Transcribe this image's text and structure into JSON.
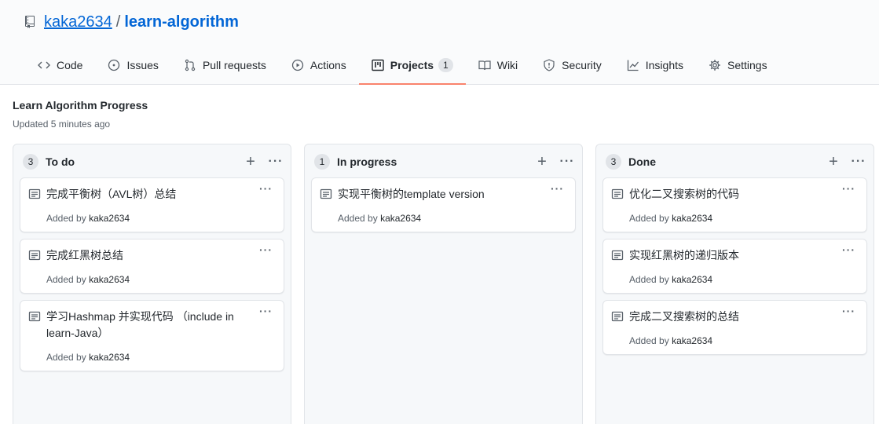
{
  "repo": {
    "owner": "kaka2634",
    "separator": "/",
    "name": "learn-algorithm"
  },
  "tabs": [
    {
      "label": "Code",
      "icon": "code-icon"
    },
    {
      "label": "Issues",
      "icon": "issue-icon"
    },
    {
      "label": "Pull requests",
      "icon": "pull-request-icon"
    },
    {
      "label": "Actions",
      "icon": "play-icon"
    },
    {
      "label": "Projects",
      "icon": "project-icon",
      "counter": "1",
      "selected": true
    },
    {
      "label": "Wiki",
      "icon": "book-icon"
    },
    {
      "label": "Security",
      "icon": "shield-icon"
    },
    {
      "label": "Insights",
      "icon": "graph-icon"
    },
    {
      "label": "Settings",
      "icon": "gear-icon"
    }
  ],
  "project": {
    "title": "Learn Algorithm Progress",
    "updated": "Updated 5 minutes ago"
  },
  "columns": [
    {
      "count": "3",
      "name": "To do",
      "add": "+",
      "menu": "···",
      "cards": [
        {
          "title": "完成平衡树（AVL树）总结",
          "added_by": "Added by",
          "user": "kaka2634",
          "menu": "···"
        },
        {
          "title": "完成红黑树总结",
          "added_by": "Added by",
          "user": "kaka2634",
          "menu": "···"
        },
        {
          "title": "学习Hashmap 并实现代码 （include in learn-Java）",
          "added_by": "Added by",
          "user": "kaka2634",
          "menu": "···"
        }
      ]
    },
    {
      "count": "1",
      "name": "In progress",
      "add": "+",
      "menu": "···",
      "cards": [
        {
          "title": "实现平衡树的template version",
          "added_by": "Added by",
          "user": "kaka2634",
          "menu": "···"
        }
      ]
    },
    {
      "count": "3",
      "name": "Done",
      "add": "+",
      "menu": "···",
      "cards": [
        {
          "title": "优化二叉搜索树的代码",
          "added_by": "Added by",
          "user": "kaka2634",
          "menu": "···"
        },
        {
          "title": "实现红黑树的递归版本",
          "added_by": "Added by",
          "user": "kaka2634",
          "menu": "···"
        },
        {
          "title": "完成二叉搜索树的总结",
          "added_by": "Added by",
          "user": "kaka2634",
          "menu": "···"
        }
      ]
    }
  ],
  "colors": {
    "link": "#0366d6",
    "tab_underline": "#f9826c",
    "muted": "#586069"
  }
}
